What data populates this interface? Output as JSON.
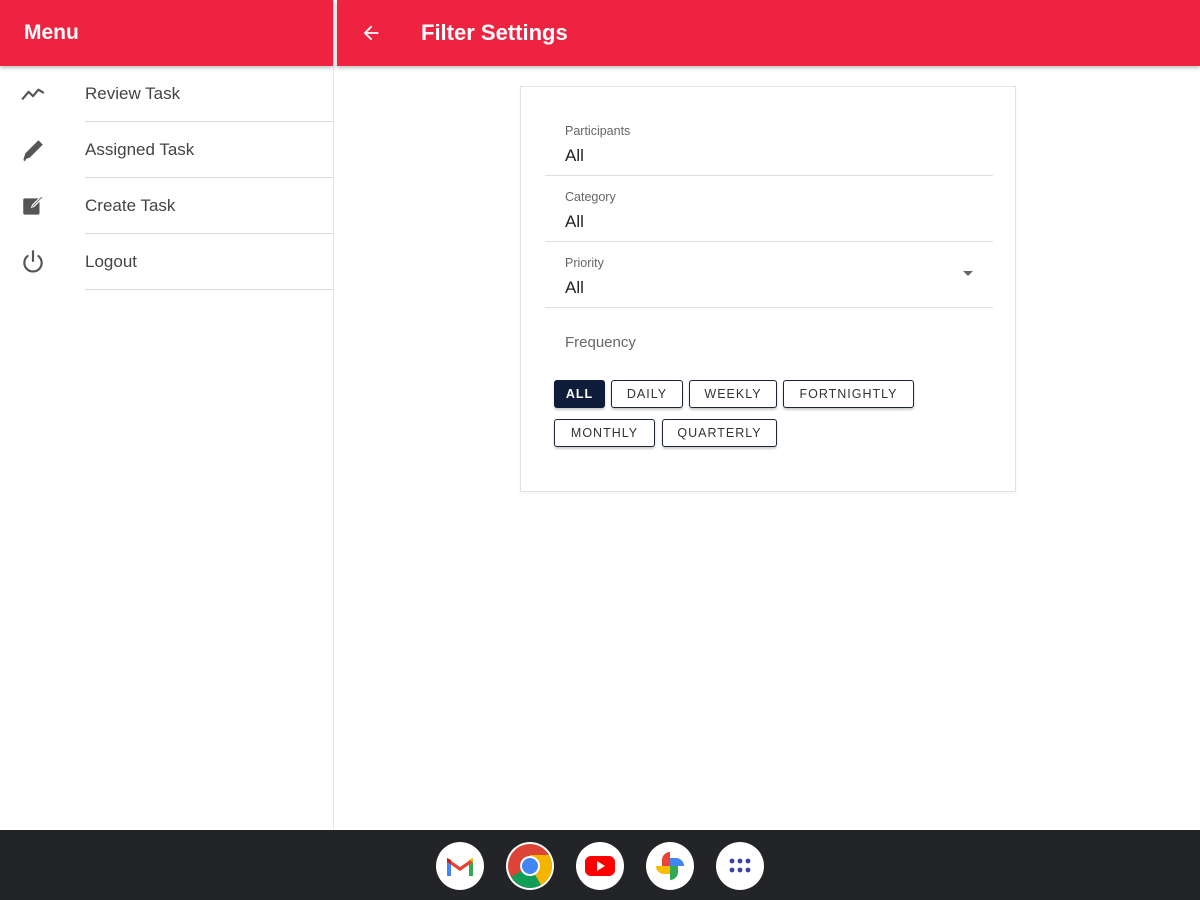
{
  "drawer": {
    "title": "Menu",
    "items": [
      {
        "label": "Review Task",
        "icon": "trending-icon"
      },
      {
        "label": "Assigned Task",
        "icon": "pencil-icon"
      },
      {
        "label": "Create Task",
        "icon": "edit-square-icon"
      },
      {
        "label": "Logout",
        "icon": "power-icon"
      }
    ]
  },
  "appbar": {
    "title": "Filter Settings",
    "back_icon": "arrow-back-icon"
  },
  "filters": {
    "participants": {
      "label": "Participants",
      "value": "All"
    },
    "category": {
      "label": "Category",
      "value": "All"
    },
    "priority": {
      "label": "Priority",
      "value": "All"
    },
    "frequency": {
      "label": "Frequency",
      "options": [
        "ALL",
        "DAILY",
        "WEEKLY",
        "FORTNIGHTLY",
        "MONTHLY",
        "QUARTERLY"
      ],
      "selected": "ALL"
    }
  },
  "shelf": {
    "apps": [
      "gmail-icon",
      "chrome-icon",
      "youtube-icon",
      "photos-icon",
      "launcher-icon"
    ]
  },
  "colors": {
    "accent": "#ee2340",
    "chip_selected": "#0f1c3a",
    "shelf": "#232427"
  }
}
